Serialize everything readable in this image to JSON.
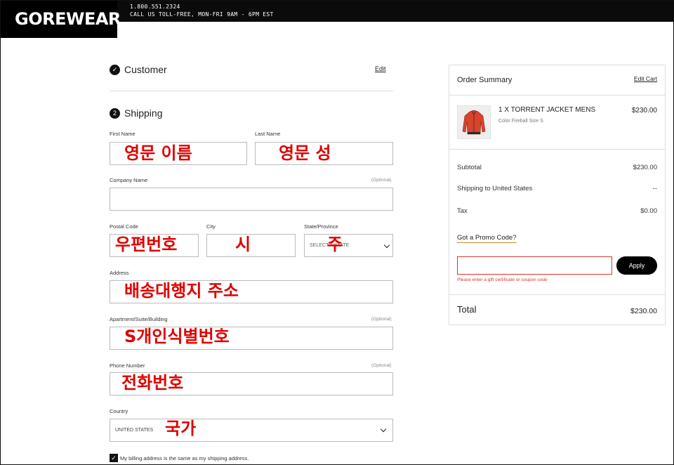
{
  "header": {
    "logo": "GOREWEAR",
    "phone": "1.800.551.2324",
    "hours": "CALL US TOLL-FREE, MON-FRI 9AM - 6PM EST"
  },
  "customer": {
    "title": "Customer",
    "edit": "Edit"
  },
  "shipping": {
    "step": "2",
    "title": "Shipping",
    "first_name": {
      "label": "First Name",
      "overlay": "영문 이름"
    },
    "last_name": {
      "label": "Last Name",
      "overlay": "영문 성"
    },
    "company": {
      "label": "Company Name",
      "optional": "(Optional)"
    },
    "postal": {
      "label": "Postal Code",
      "overlay": "우편번호"
    },
    "city": {
      "label": "City",
      "overlay": "시"
    },
    "state": {
      "label": "State/Province",
      "placeholder": "SELECT A STATE",
      "overlay": "주"
    },
    "address": {
      "label": "Address",
      "overlay": "배송대행지 주소"
    },
    "apartment": {
      "label": "Apartment/Suite/Building",
      "optional": "(Optional)",
      "overlay": "S개인식별번호"
    },
    "phone": {
      "label": "Phone Number",
      "optional": "(Optional)",
      "overlay": "전화번호"
    },
    "country": {
      "label": "Country",
      "value": "UNITED STATES",
      "overlay": "국가"
    },
    "billing_same": "My billing address is the same as my shipping address."
  },
  "summary": {
    "title": "Order Summary",
    "edit": "Edit Cart",
    "product": {
      "name": "1 X TORRENT JACKET MENS",
      "meta": "Color Fireball  Size S",
      "price": "$230.00"
    },
    "subtotal_label": "Subtotal",
    "subtotal": "$230.00",
    "shipping_label": "Shipping to United States",
    "shipping": "--",
    "tax_label": "Tax",
    "tax": "$0.00",
    "promo_link": "Got a Promo Code?",
    "promo_value": "",
    "apply": "Apply",
    "promo_error": "Please enter a gift certificate or coupon code",
    "total_label": "Total",
    "total": "$230.00"
  },
  "colors": {
    "overlay": "#e00000",
    "accent_underline": "#d4852b",
    "error": "#d8372f",
    "jacket": "#d8432e"
  }
}
